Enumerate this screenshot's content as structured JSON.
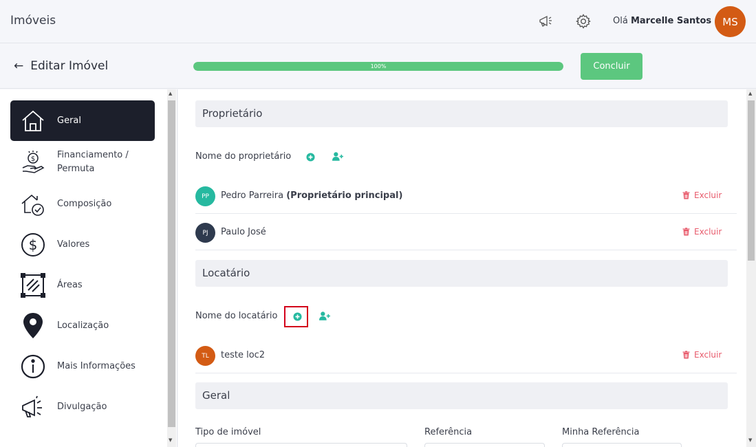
{
  "app": {
    "title": "Imóveis"
  },
  "header": {
    "greeting_prefix": "Olá",
    "user_name": "Marcelle Santos",
    "avatar_initials": "MS",
    "avatar_color": "#d35b14"
  },
  "subheader": {
    "back_label": "Editar Imóvel",
    "progress_text": "100%",
    "progress_value": 100,
    "conclude_label": "Concluir"
  },
  "sidebar": {
    "items": [
      {
        "label": "Geral",
        "icon": "home-icon",
        "active": true
      },
      {
        "label": "Financiamento /",
        "label2": "Permuta",
        "icon": "money-hand-icon"
      },
      {
        "label": "Composição",
        "icon": "house-check-icon"
      },
      {
        "label": "Valores",
        "icon": "dollar-circle-icon"
      },
      {
        "label": "Áreas",
        "icon": "area-icon"
      },
      {
        "label": "Localização",
        "icon": "map-pin-icon"
      },
      {
        "label": "Mais Informações",
        "icon": "info-icon"
      },
      {
        "label": "Divulgação",
        "icon": "megaphone-icon"
      }
    ]
  },
  "owner_section": {
    "title": "Proprietário",
    "field_label": "Nome do proprietário",
    "people": [
      {
        "initials": "PP",
        "name": "Pedro Parreira",
        "suffix": "(Proprietário principal)",
        "color": "#26b9a0",
        "delete_label": "Excluir"
      },
      {
        "initials": "PJ",
        "name": "Paulo José",
        "suffix": "",
        "color": "#2e3a4e",
        "delete_label": "Excluir"
      }
    ]
  },
  "tenant_section": {
    "title": "Locatário",
    "field_label": "Nome do locatário",
    "people": [
      {
        "initials": "TL",
        "name": "teste loc2",
        "color": "#d35b14",
        "delete_label": "Excluir"
      }
    ]
  },
  "general_section": {
    "title": "Geral",
    "labels": {
      "tipo": "Tipo de imóvel",
      "referencia": "Referência",
      "minha_referencia": "Minha Referência"
    }
  },
  "colors": {
    "accent": "#26b9a0",
    "success": "#5cc77f",
    "danger": "#e85a6b",
    "highlight": "#d3001a"
  }
}
